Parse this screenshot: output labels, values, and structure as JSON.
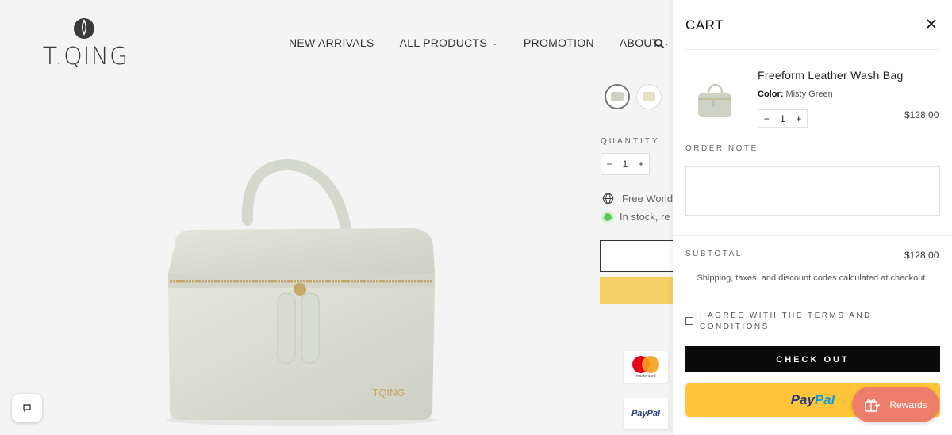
{
  "brand": {
    "logo_text": "T.QING"
  },
  "nav": {
    "items": [
      {
        "label": "NEW ARRIVALS",
        "has_dropdown": false
      },
      {
        "label": "ALL PRODUCTS",
        "has_dropdown": true
      },
      {
        "label": "PROMOTION",
        "has_dropdown": false
      },
      {
        "label": "ABOUT",
        "has_dropdown": true
      }
    ],
    "search_icon": "search-icon"
  },
  "product": {
    "image_logo_text": "TQING",
    "zipper_tag_text": "TQING",
    "quantity_label": "QUANTITY",
    "quantity": "1",
    "shipping_text": "Free World",
    "stock_text": "In stock, re"
  },
  "payment_icons": {
    "mastercard_text": "mastercard",
    "paypal_text": "PayPal"
  },
  "cart": {
    "title": "CART",
    "item": {
      "name": "Freeform Leather Wash Bag",
      "variant_label": "Color:",
      "variant_value": "Misty Green",
      "quantity": "1",
      "price": "$128.00",
      "minus": "−",
      "plus": "+"
    },
    "order_note_label": "ORDER NOTE",
    "subtotal_label": "SUBTOTAL",
    "subtotal_value": "$128.00",
    "shipping_note": "Shipping, taxes, and discount codes calculated at checkout.",
    "terms_label": "I AGREE WITH THE TERMS AND CONDITIONS",
    "checkout_label": "CHECK OUT",
    "paypal_label_1": "Pay",
    "paypal_label_2": "Pal"
  },
  "rewards": {
    "label": "Rewards"
  },
  "colors": {
    "accent_paypal": "#ffc439",
    "rewards": "#ef7d6b",
    "checkout": "#0a0a0a",
    "bag": "#d9dcd0",
    "stock_dot": "#5ac95a"
  }
}
